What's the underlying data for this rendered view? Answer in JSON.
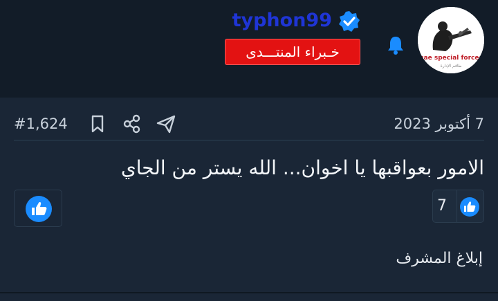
{
  "user": {
    "username": "typhon99",
    "role_badge": "خـبراء المنتـــدى",
    "avatar_caption": "uae special forces",
    "avatar_subcaption": "طاقم الإدارة"
  },
  "post": {
    "date": "7 أكتوبر 2023",
    "number": "#1,624",
    "message": "الامور بعواقبها يا اخوان... الله يستر من الجاي",
    "reaction_count": "7",
    "report_label": "إبلاغ المشرف"
  },
  "colors": {
    "background": "#1a2636",
    "header": "#121c28",
    "username": "#1f35d6",
    "badge": "#e31212",
    "accent_blue": "#1a8cff"
  },
  "icons": {
    "verified": "verified-badge-icon",
    "bell": "bell-icon",
    "share": "share-icon",
    "bookmark": "bookmark-icon",
    "send": "send-icon",
    "like": "thumbs-up-icon"
  }
}
